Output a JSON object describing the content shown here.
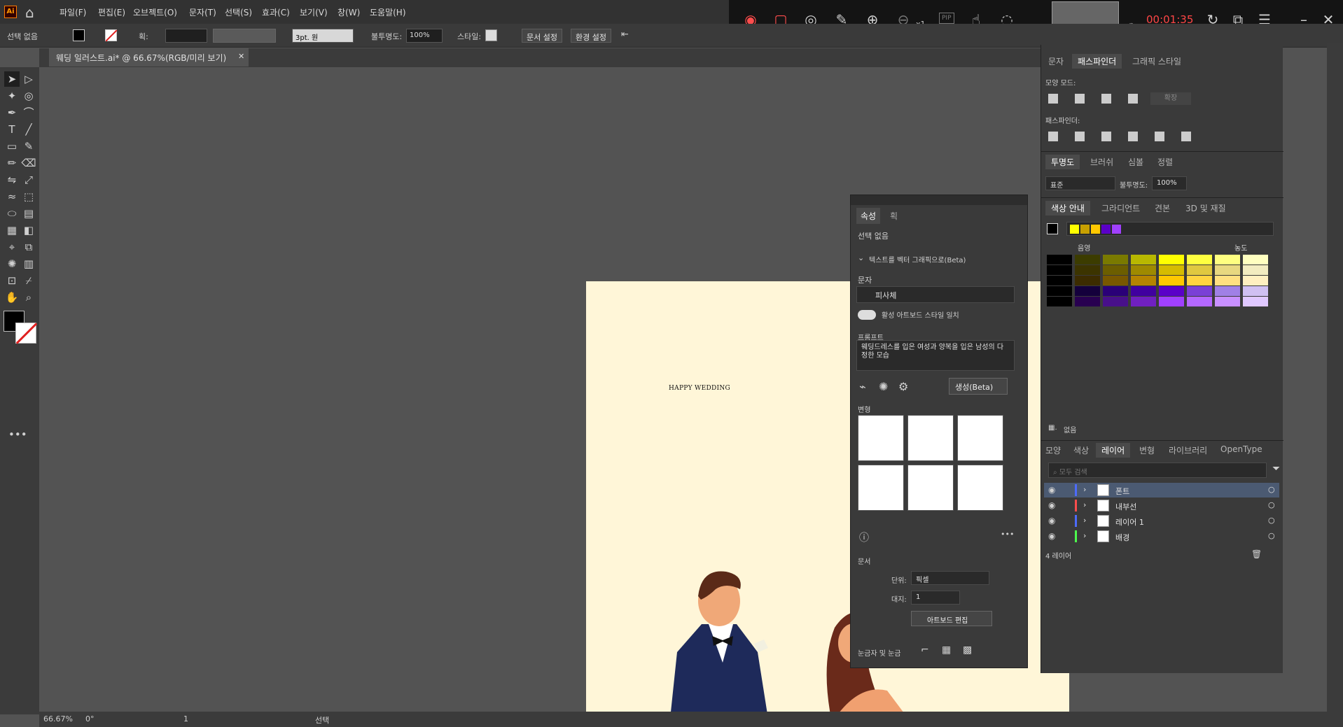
{
  "menubar": {
    "logo": "Ai",
    "items": [
      "파일(F)",
      "편집(E)",
      "오브젝트(O)",
      "문자(T)",
      "선택(S)",
      "효과(C)",
      "보기(V)",
      "창(W)",
      "도움말(H)"
    ]
  },
  "recorder": {
    "timer": "00:01:35",
    "zoom_mult": "x1",
    "pip": "PIP"
  },
  "controlbar": {
    "selection": "선택 없음",
    "stroke_label": "획:",
    "brush": "3pt. 원",
    "opacity_label": "불투명도:",
    "opacity_value": "100%",
    "style_label": "스타일:",
    "doc_setup": "문서 설정",
    "preferences": "환경 설정"
  },
  "document": {
    "tab_title": "웨딩 일러스트.ai* @ 66.67%(RGB/미리 보기)"
  },
  "artboard": {
    "title": "HAPPY WEDDING"
  },
  "statusbar": {
    "zoom": "66.67%",
    "rotation": "0°",
    "artboard_num": "1",
    "tool": "선택"
  },
  "properties": {
    "tabs": [
      "속성",
      "획"
    ],
    "selection": "선택 없음",
    "section_title": "텍스트를 벡터 그래픽으로(Beta)",
    "subject_label": "문자",
    "subject_value": "피사체",
    "toggle_label": "활성 아트보드 스타일 일치",
    "prompt_label": "프롬프트",
    "prompt_text": "웨딩드레스를 입은 여성과 양복을 입은 남성의 다정한 모습",
    "generate_button": "생성(Beta)",
    "variations_label": "변형",
    "document_label": "문서",
    "unit_label": "단위:",
    "unit_value": "픽셀",
    "artboard_label": "대지:",
    "artboard_value": "1",
    "edit_artboard": "아트보드 편집",
    "rulers_label": "눈금자 및 눈금"
  },
  "dock": {
    "pathfinder_tabs": [
      "문자",
      "패스파인더",
      "그래픽 스타일"
    ],
    "shape_modes": "모양 모드:",
    "expand": "확장",
    "pathfinders": "패스파인더:",
    "transparency_tabs": [
      "투명도",
      "브러쉬",
      "심볼",
      "정렬"
    ],
    "blend_mode": "표준",
    "opacity_label": "불투명도:",
    "opacity_value": "100%",
    "color_guide_tabs": [
      "색상 안내",
      "그라디언트",
      "견본",
      "3D 및 재질"
    ],
    "shade_label": "음영",
    "tint_label": "농도",
    "none_label": "없음",
    "layers_tabs": [
      "모양",
      "색상",
      "레이어",
      "변형",
      "라이브러리",
      "OpenType"
    ],
    "search_placeholder": "모두 검색",
    "layers": [
      "폰트",
      "내부선",
      "레이어 1",
      "배경"
    ],
    "layer_count": "4 레이어"
  },
  "colors": {
    "harmony": [
      "#ffff00",
      "#c8a000",
      "#ffc800",
      "#5a00c8",
      "#a040ff"
    ],
    "guide_rows": [
      [
        "#000000",
        "#3c3c00",
        "#7a7a00",
        "#b8b800",
        "#ffff00",
        "#ffff40",
        "#ffff80",
        "#ffffc0"
      ],
      [
        "#000000",
        "#3c3400",
        "#6c5e00",
        "#9e8a00",
        "#d6bc00",
        "#e0c840",
        "#e8d880",
        "#f2ecc0"
      ],
      [
        "#000000",
        "#3c2c00",
        "#785800",
        "#b48400",
        "#ffc800",
        "#ffd440",
        "#ffe080",
        "#fff0c0"
      ],
      [
        "#000000",
        "#14003c",
        "#2a0078",
        "#4000a0",
        "#5a00c8",
        "#7a40d6",
        "#a080e6",
        "#d0c0f2"
      ],
      [
        "#000000",
        "#280050",
        "#48108a",
        "#7020c0",
        "#a040ff",
        "#b468ff",
        "#c890ff",
        "#e0c8ff"
      ]
    ],
    "layer_colors": [
      "#4d6bff",
      "#ff4d4d",
      "#4d6bff",
      "#4dff4d"
    ]
  }
}
